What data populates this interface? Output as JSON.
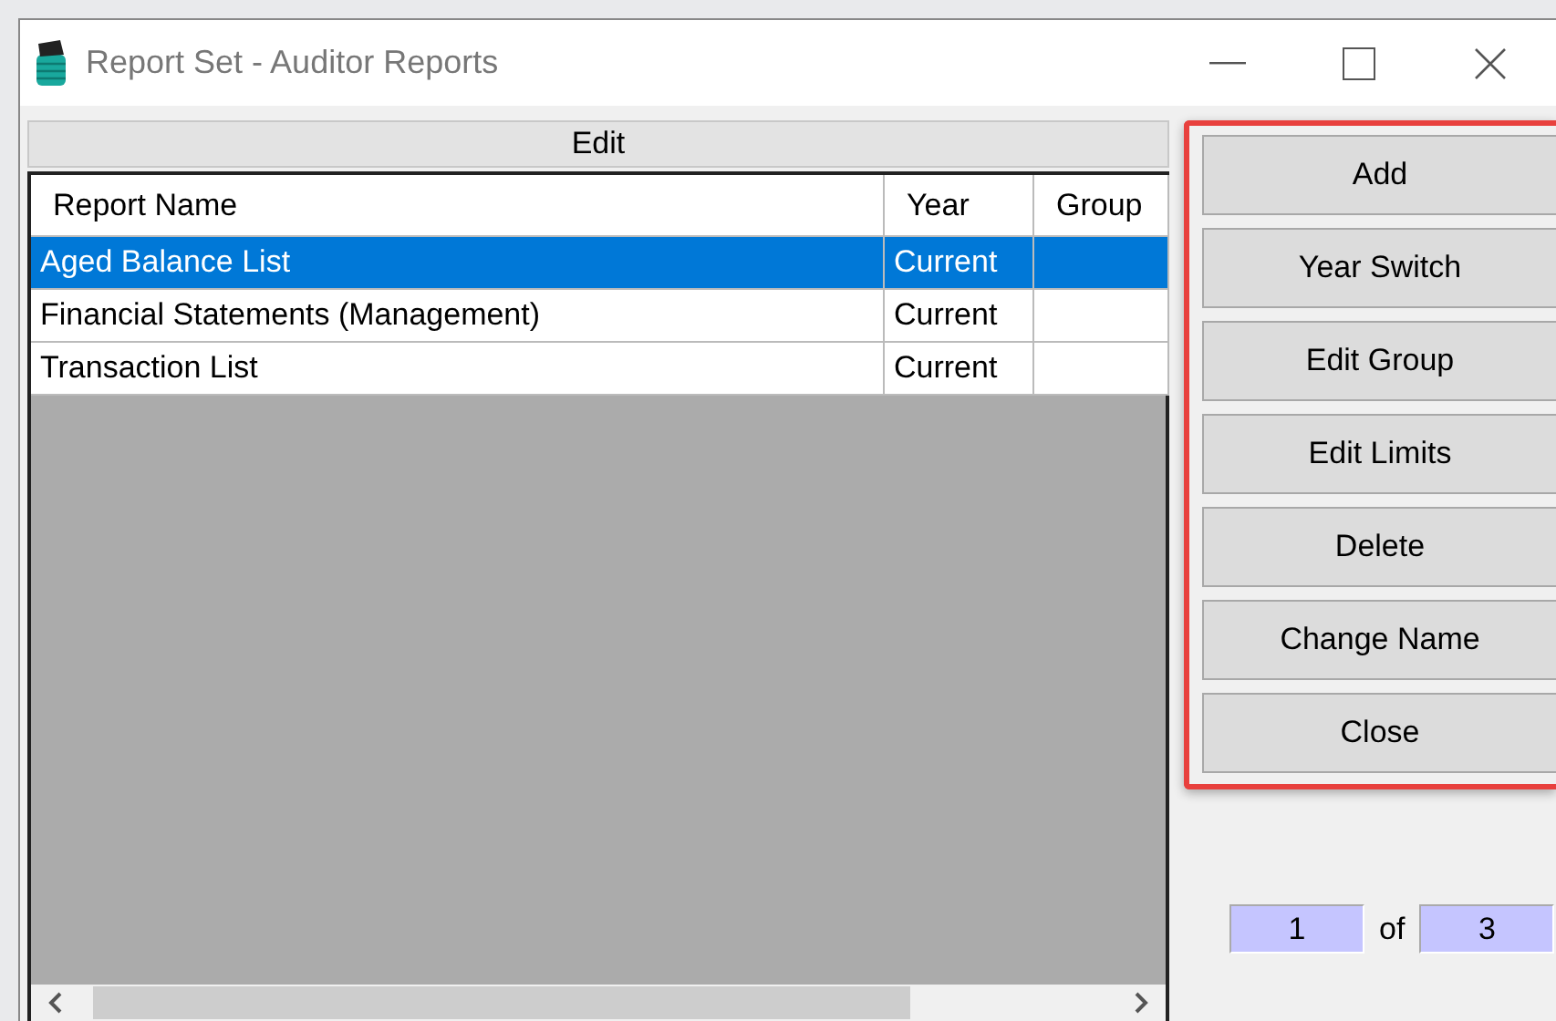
{
  "window": {
    "title": "Report Set - Auditor Reports"
  },
  "panel": {
    "title": "Edit"
  },
  "table": {
    "columns": [
      "Report Name",
      "Year",
      "Group"
    ],
    "rows": [
      {
        "cells": [
          "Aged Balance List",
          "Current",
          ""
        ],
        "selected": true
      },
      {
        "cells": [
          "Financial Statements (Management)",
          "Current",
          ""
        ],
        "selected": false
      },
      {
        "cells": [
          "Transaction List",
          "Current",
          ""
        ],
        "selected": false
      }
    ]
  },
  "buttons": [
    "Add",
    "Year Switch",
    "Edit Group",
    "Edit Limits",
    "Delete",
    "Change Name",
    "Close"
  ],
  "pager": {
    "current": "1",
    "separator": "of",
    "total": "3"
  }
}
